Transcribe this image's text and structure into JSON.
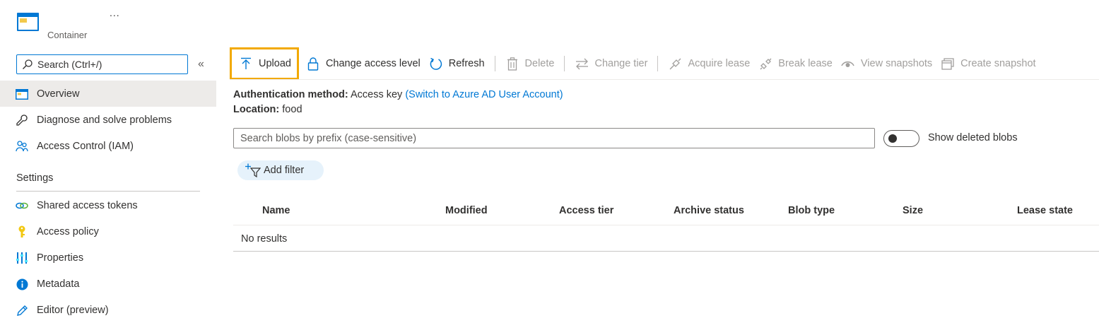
{
  "header": {
    "more_icon": "ellipsis-icon",
    "more_label": "...",
    "subtitle": "Container",
    "icon": "container-icon"
  },
  "sidebar": {
    "search_placeholder": "Search (Ctrl+/)",
    "collapse_label": "«",
    "items": [
      {
        "label": "Overview",
        "icon": "container-icon",
        "active": true
      },
      {
        "label": "Diagnose and solve problems",
        "icon": "wrench-icon"
      },
      {
        "label": "Access Control (IAM)",
        "icon": "people-icon"
      }
    ],
    "settings_heading": "Settings",
    "settings_items": [
      {
        "label": "Shared access tokens",
        "icon": "link-icon"
      },
      {
        "label": "Access policy",
        "icon": "key-icon"
      },
      {
        "label": "Properties",
        "icon": "properties-icon"
      },
      {
        "label": "Metadata",
        "icon": "info-icon"
      },
      {
        "label": "Editor (preview)",
        "icon": "pencil-icon"
      }
    ]
  },
  "toolbar": {
    "upload": "Upload",
    "change_access_level": "Change access level",
    "refresh": "Refresh",
    "delete": "Delete",
    "change_tier": "Change tier",
    "acquire_lease": "Acquire lease",
    "break_lease": "Break lease",
    "view_snapshots": "View snapshots",
    "create_snapshot": "Create snapshot"
  },
  "info": {
    "auth_label": "Authentication method:",
    "auth_value": "Access key",
    "auth_link": "(Switch to Azure AD User Account)",
    "location_label": "Location:",
    "location_value": "food"
  },
  "filters": {
    "search_placeholder": "Search blobs by prefix (case-sensitive)",
    "show_deleted_label": "Show deleted blobs",
    "show_deleted_on": false,
    "add_filter_label": "Add filter"
  },
  "table": {
    "columns": [
      "Name",
      "Modified",
      "Access tier",
      "Archive status",
      "Blob type",
      "Size",
      "Lease state"
    ],
    "empty_message": "No results"
  },
  "colors": {
    "accent": "#0078d4",
    "highlight": "#f2a900",
    "active_bg": "#edebe9"
  }
}
